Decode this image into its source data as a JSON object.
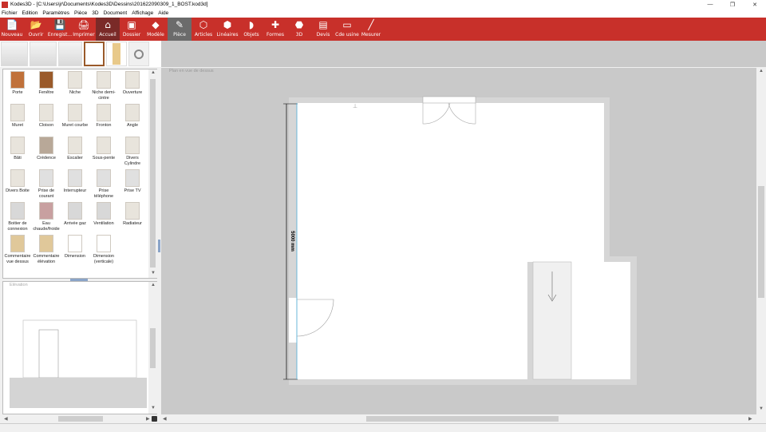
{
  "window": {
    "title": "Kodes3D - [C:\\Users\\jr\\Documents\\Kodes3D\\Dessins\\201622090309_1_BOST.kod3d]",
    "min": "—",
    "max": "❐",
    "close": "✕"
  },
  "menu": [
    "Fichier",
    "Edition",
    "Paramètres",
    "Pièce",
    "3D",
    "Document",
    "Affichage",
    "Aide"
  ],
  "ribbon": [
    {
      "label": "Nouveau",
      "icon": "📄"
    },
    {
      "label": "Ouvrir",
      "icon": "📂"
    },
    {
      "label": "Enregist...",
      "icon": "💾"
    },
    {
      "label": "Imprimer",
      "icon": "🖨"
    },
    {
      "label": "Accueil",
      "icon": "⌂"
    },
    {
      "label": "Dossier",
      "icon": "▣"
    },
    {
      "label": "Modèle",
      "icon": "◆"
    },
    {
      "label": "Pièce",
      "icon": "✎"
    },
    {
      "label": "Articles",
      "icon": "⬡"
    },
    {
      "label": "Linéaires",
      "icon": "⬢"
    },
    {
      "label": "Objets",
      "icon": "◗"
    },
    {
      "label": "Formes",
      "icon": "✚"
    },
    {
      "label": "3D",
      "icon": "⬣"
    },
    {
      "label": "Devis",
      "icon": "▤"
    },
    {
      "label": "Cde usine",
      "icon": "▭"
    },
    {
      "label": "Mesurer",
      "icon": "╱"
    }
  ],
  "palette": [
    {
      "label": "Porte",
      "color": "#c0713a"
    },
    {
      "label": "Fenêtre",
      "color": "#9a5a2a"
    },
    {
      "label": "Niche",
      "color": "#e8e4dc"
    },
    {
      "label": "Niche demi-cintre",
      "color": "#e8e4dc"
    },
    {
      "label": "Ouverture",
      "color": "#e8e4dc"
    },
    {
      "label": "Muret",
      "color": "#e8e4dc"
    },
    {
      "label": "Cloison",
      "color": "#e8e4dc"
    },
    {
      "label": "Muret courbe",
      "color": "#e8e4dc"
    },
    {
      "label": "Fronton",
      "color": "#e8e4dc"
    },
    {
      "label": "Angle",
      "color": "#e8e4dc"
    },
    {
      "label": "Bâti",
      "color": "#e8e4dc"
    },
    {
      "label": "Crédence",
      "color": "#b8a898"
    },
    {
      "label": "Escalier",
      "color": "#e8e4dc"
    },
    {
      "label": "Sous-pente",
      "color": "#e8e4dc"
    },
    {
      "label": "Divers Cylindre",
      "color": "#e8e4dc"
    },
    {
      "label": "Divers Boite",
      "color": "#e8e4dc"
    },
    {
      "label": "Prise de courant",
      "color": "#e0e0e0"
    },
    {
      "label": "Interrupteur",
      "color": "#e0e0e0"
    },
    {
      "label": "Prise téléphone",
      "color": "#e0e0e0"
    },
    {
      "label": "Prise TV",
      "color": "#e0e0e0"
    },
    {
      "label": "Boitier de connexion",
      "color": "#d8d8d8"
    },
    {
      "label": "Eau chaude/froide",
      "color": "#c8a0a0"
    },
    {
      "label": "Arrivée gaz",
      "color": "#d8d8d8"
    },
    {
      "label": "Ventilation",
      "color": "#d8d8d8"
    },
    {
      "label": "Radiateur",
      "color": "#e8e4dc"
    },
    {
      "label": "Commentaire vue dessus",
      "color": "#e0c89a"
    },
    {
      "label": "Commentaire élévation",
      "color": "#e0c89a"
    },
    {
      "label": "Dimension",
      "color": "#ffffff"
    },
    {
      "label": "Dimension (verticale)",
      "color": "#ffffff"
    }
  ],
  "elevation": {
    "title": "Elévation"
  },
  "plan": {
    "label": "Plan en vue de dessus",
    "dimension": "5000 mm"
  },
  "colors": {
    "ribbon": "#c8302a",
    "canvas_bg": "#c9c9c9",
    "wall": "#d6d6d6",
    "dimension_line": "#6ab7d8"
  }
}
